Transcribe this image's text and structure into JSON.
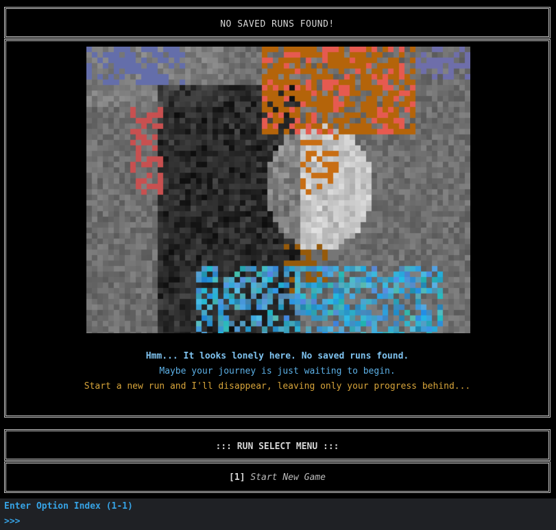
{
  "title_box": {
    "text": "NO SAVED RUNS FOUND!"
  },
  "content": {
    "image_alt": "pixelated portrait of a character",
    "message_lines": [
      "Hmm... It looks lonely here. No saved runs found.",
      "Maybe your journey is just waiting to begin.",
      "Start a new run and I'll disappear, leaving only your progress behind..."
    ],
    "colors": {
      "line1": "#7fc3f0",
      "line2": "#5cb0e6",
      "line3": "#d7a43a"
    }
  },
  "menu": {
    "title": "::: RUN SELECT MENU :::",
    "options": [
      {
        "index": "[1]",
        "label": "Start New Game"
      }
    ]
  },
  "prompt": {
    "label": "Enter Option Index (1-1)",
    "marker": ">>>"
  },
  "palette": {
    "background": "#000000",
    "terminal_bg": "#1f2125",
    "border": "#c7c7c7",
    "prompt": "#36a3e5"
  }
}
